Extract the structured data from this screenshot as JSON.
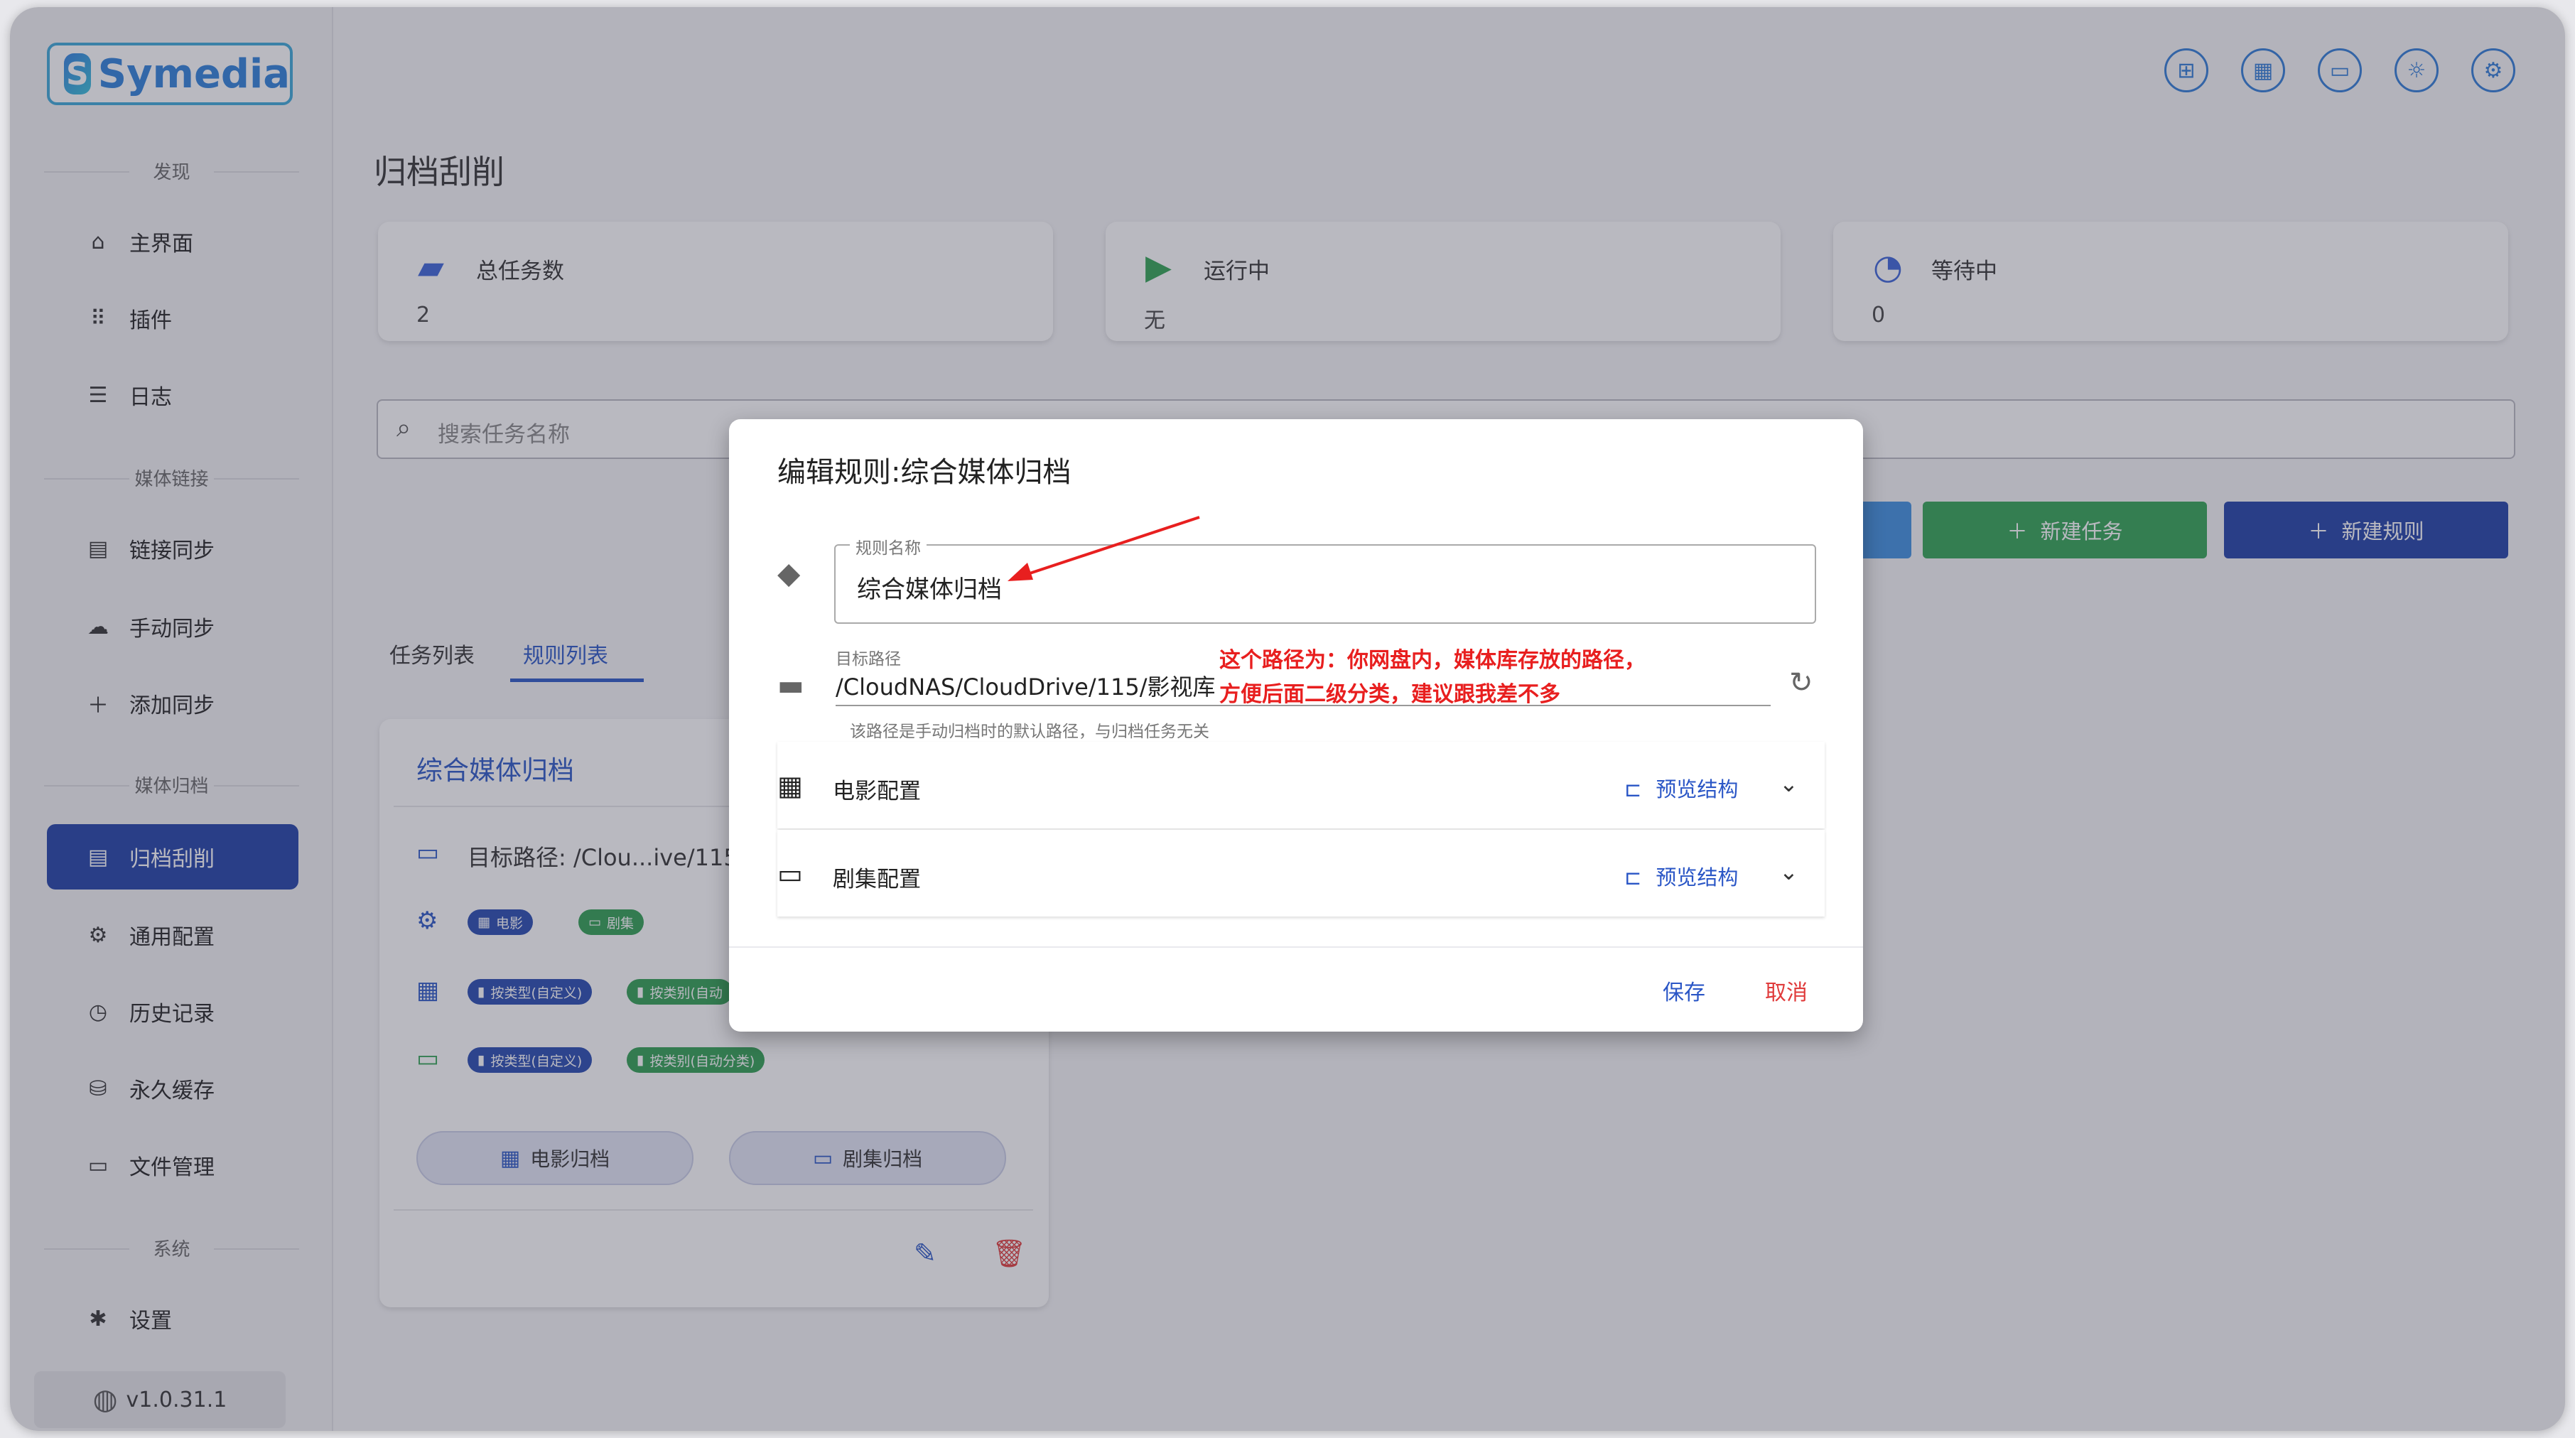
{
  "app": {
    "logo_text": "Symedia",
    "logo_mark": "S",
    "version": "v1.0.31.1"
  },
  "sidebar": {
    "sections": [
      {
        "label": "发现"
      },
      {
        "label": "媒体链接"
      },
      {
        "label": "媒体归档"
      },
      {
        "label": "系统"
      }
    ],
    "items": [
      {
        "label": "主界面",
        "icon": "home-icon"
      },
      {
        "label": "插件",
        "icon": "grid-icon"
      },
      {
        "label": "日志",
        "icon": "list-icon"
      },
      {
        "label": "链接同步",
        "icon": "table-icon"
      },
      {
        "label": "手动同步",
        "icon": "cloud-icon"
      },
      {
        "label": "添加同步",
        "icon": "plus-icon"
      },
      {
        "label": "归档刮削",
        "icon": "table-icon",
        "active": true
      },
      {
        "label": "通用配置",
        "icon": "gear-icon"
      },
      {
        "label": "历史记录",
        "icon": "history-icon"
      },
      {
        "label": "永久缓存",
        "icon": "database-icon"
      },
      {
        "label": "文件管理",
        "icon": "folder-open-icon"
      },
      {
        "label": "设置",
        "icon": "settings-icon"
      }
    ]
  },
  "top_icons": [
    "apps-icon",
    "calendar-icon",
    "monitor-icon",
    "sun-icon",
    "settings-circle-icon"
  ],
  "page": {
    "title": "归档刮削"
  },
  "stats": [
    {
      "label": "总任务数",
      "value": "2",
      "icon": "folder-sync-icon",
      "color": "#3a63d8"
    },
    {
      "label": "运行中",
      "value": "无",
      "icon": "play-icon",
      "color": "#2fa352"
    },
    {
      "label": "等待中",
      "value": "0",
      "icon": "clock-icon",
      "color": "#3a63d8"
    }
  ],
  "search": {
    "placeholder": "搜索任务名称"
  },
  "actions": {
    "new_task": "新建任务",
    "new_rule": "新建规则"
  },
  "tabs": [
    {
      "label": "任务列表"
    },
    {
      "label": "规则列表",
      "active": true
    }
  ],
  "rule_card": {
    "title": "综合媒体归档",
    "target_path": "目标路径: /Clou...ive/115",
    "config_chips": [
      "电影",
      "剧集"
    ],
    "movie_chips": [
      "按类型(自定义)",
      "按类别(自动"
    ],
    "tv_chips": [
      "按类型(自定义)",
      "按类别(自动分类)"
    ],
    "movie_archive": "电影归档",
    "tv_archive": "剧集归档"
  },
  "dialog": {
    "title": "编辑规则:综合媒体归档",
    "name_label": "规则名称",
    "name_value": "综合媒体归档",
    "target_label": "目标路径",
    "target_value": "/CloudNAS/CloudDrive/115/影视库",
    "target_hint": "该路径是手动归档时的默认路径，与归档任务无关",
    "annotation_line1": "这个路径为：你网盘内，媒体库存放的路径，",
    "annotation_line2": "方便后面二级分类，建议跟我差不多",
    "configs": [
      {
        "label": "电影配置",
        "preview": "预览结构",
        "icon": "movie-clapper-icon"
      },
      {
        "label": "剧集配置",
        "preview": "预览结构",
        "icon": "tv-icon"
      }
    ],
    "save": "保存",
    "cancel": "取消"
  },
  "colors": {
    "primary": "#2a56c6",
    "active_nav": "#1e3fa6",
    "green": "#2fa352",
    "red": "#e03b3b",
    "light_blue": "#3d8fe0",
    "annotation": "#e81f1f"
  }
}
